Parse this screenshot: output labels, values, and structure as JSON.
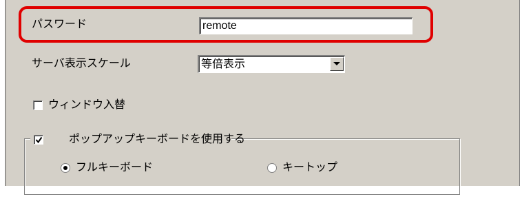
{
  "form": {
    "password_label": "パスワード",
    "password_value": "remote",
    "scale_label": "サーバ表示スケール",
    "scale_value": "等倍表示",
    "window_swap_label": "ウィンドウ入替",
    "window_swap_checked": false,
    "popup_keyboard_label": "ポップアップキーボードを使用する",
    "popup_keyboard_checked": true,
    "radio_full_keyboard_label": "フルキーボード",
    "radio_full_keyboard_selected": true,
    "radio_keytop_label": "キートップ",
    "radio_keytop_selected": false
  },
  "colors": {
    "highlight": "#e00000",
    "panel_background": "#d4d0c8"
  }
}
